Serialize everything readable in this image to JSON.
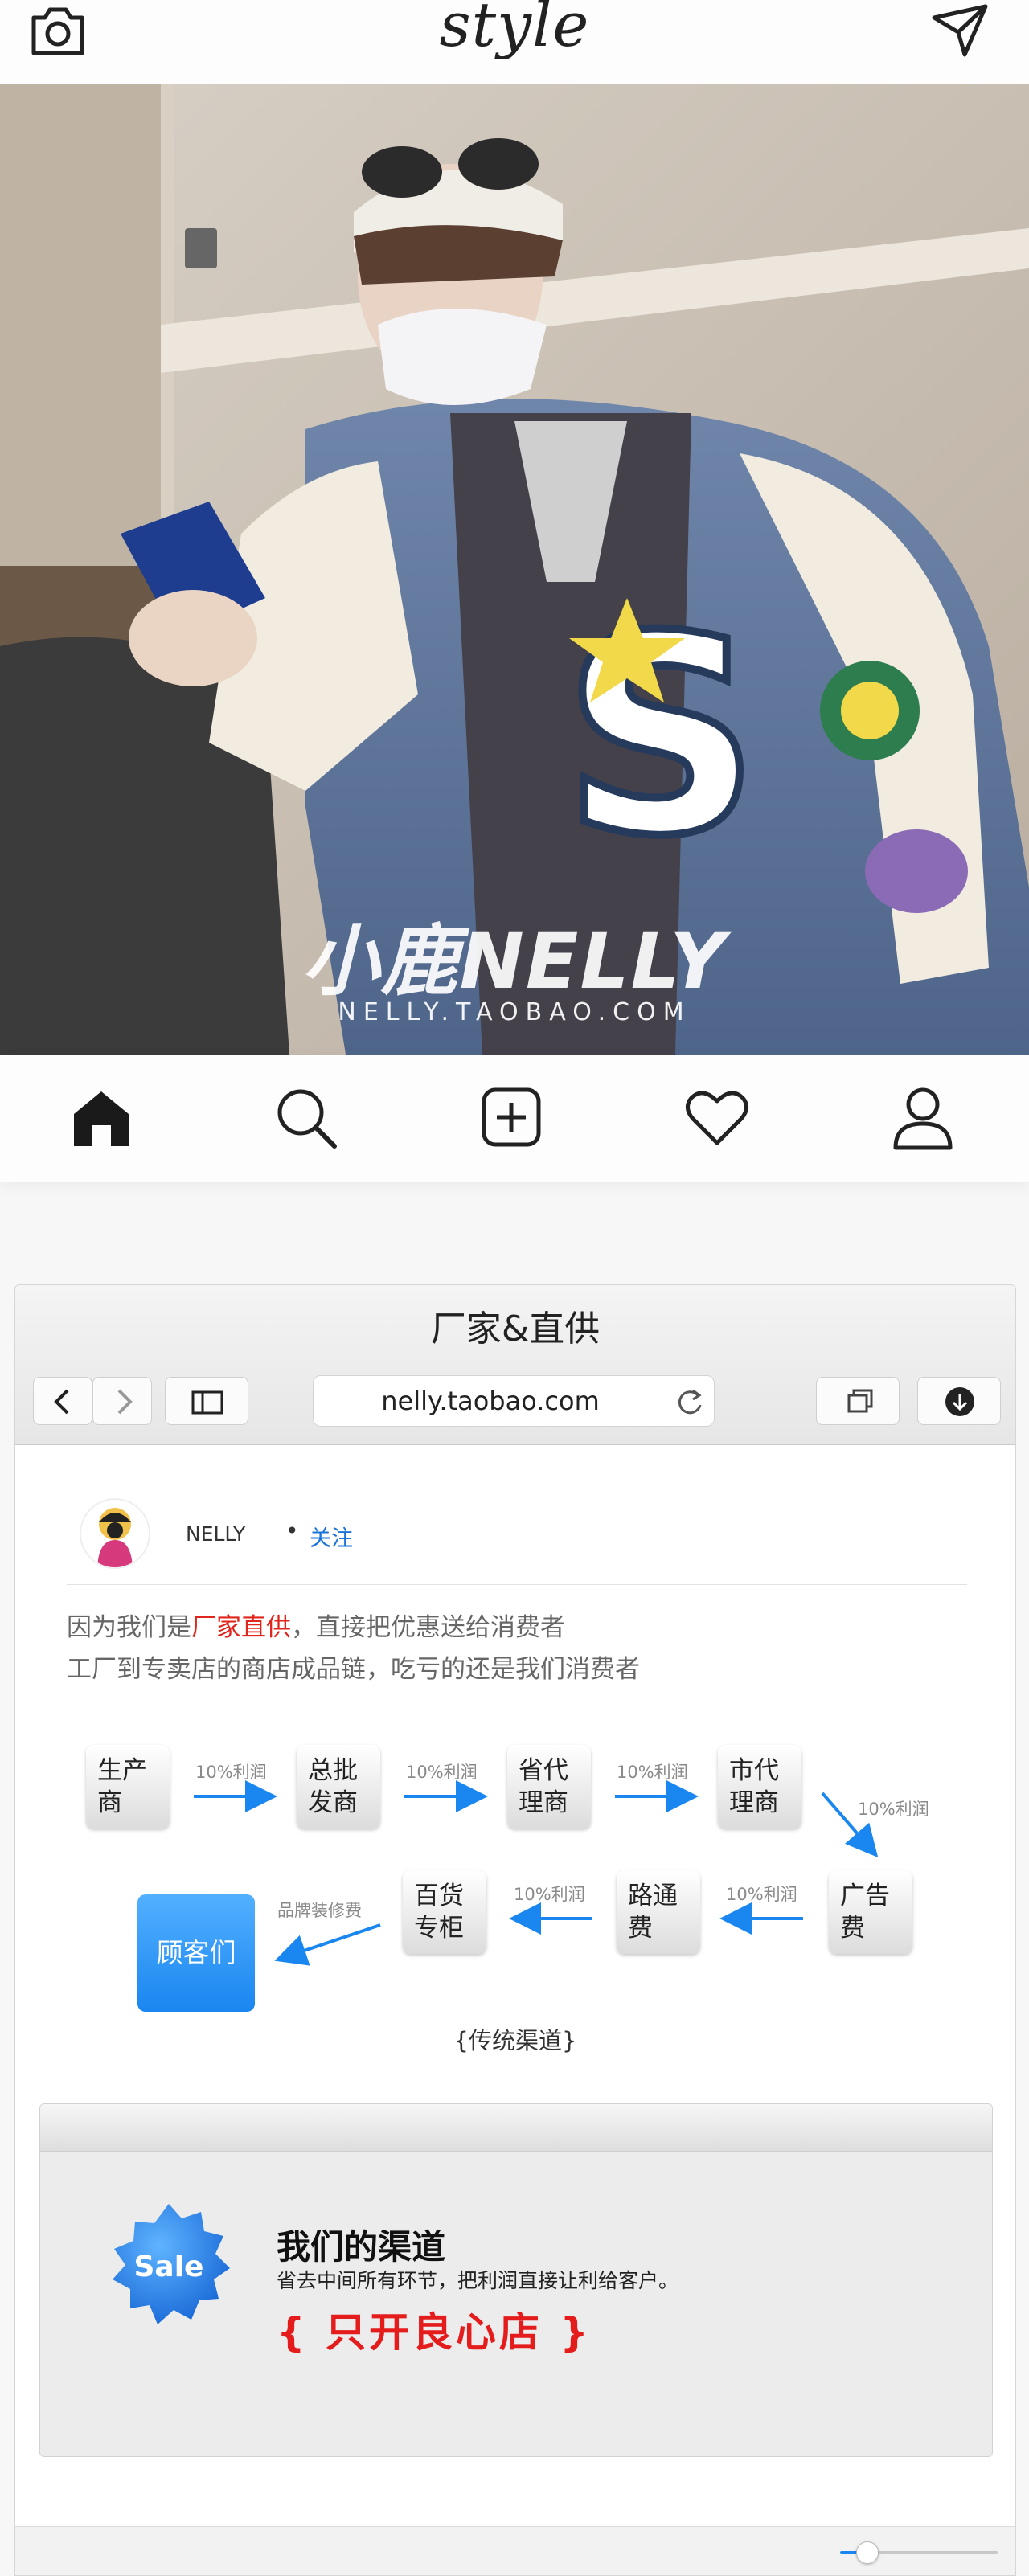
{
  "app": {
    "logo": "style"
  },
  "hero": {
    "brand_text": "小鹿NELLY",
    "url_text": "NELLY.TAOBAO.COM"
  },
  "nav": {
    "items": [
      "home-icon",
      "search-icon",
      "add-post-icon",
      "heart-icon",
      "profile-icon"
    ]
  },
  "window": {
    "title": "厂家&直供",
    "url": "nelly.taobao.com"
  },
  "post": {
    "username": "NELLY",
    "dot": "•",
    "follow": "关注",
    "desc_line1_pre": "因为我们是",
    "desc_line1_highlight": "厂家直供",
    "desc_line1_post": "，直接把优惠送给消费者",
    "desc_line2": "工厂到专卖店的商店成品链，吃亏的还是我们消费者"
  },
  "flow": {
    "row1": [
      {
        "l1": "生产",
        "l2": "商"
      },
      {
        "l1": "总批",
        "l2": "发商"
      },
      {
        "l1": "省代",
        "l2": "理商"
      },
      {
        "l1": "市代",
        "l2": "理商"
      }
    ],
    "row2": [
      {
        "l1": "百货",
        "l2": "专柜"
      },
      {
        "l1": "路通",
        "l2": "费"
      },
      {
        "l1": "广告",
        "l2": "费"
      }
    ],
    "margin_label": "10%利润",
    "decor_label": "品牌装修费",
    "customer": "顾客们",
    "caption": "{传统渠道}"
  },
  "channel": {
    "badge": "Sale",
    "title": "我们的渠道",
    "desc": "省去中间所有环节，把利润直接让利给客户。",
    "slogan": "{ 只开良心店 }"
  },
  "slider": {
    "value": 0.17
  },
  "colors": {
    "accent_blue": "#1a86f0",
    "highlight_red": "#e0261c"
  }
}
